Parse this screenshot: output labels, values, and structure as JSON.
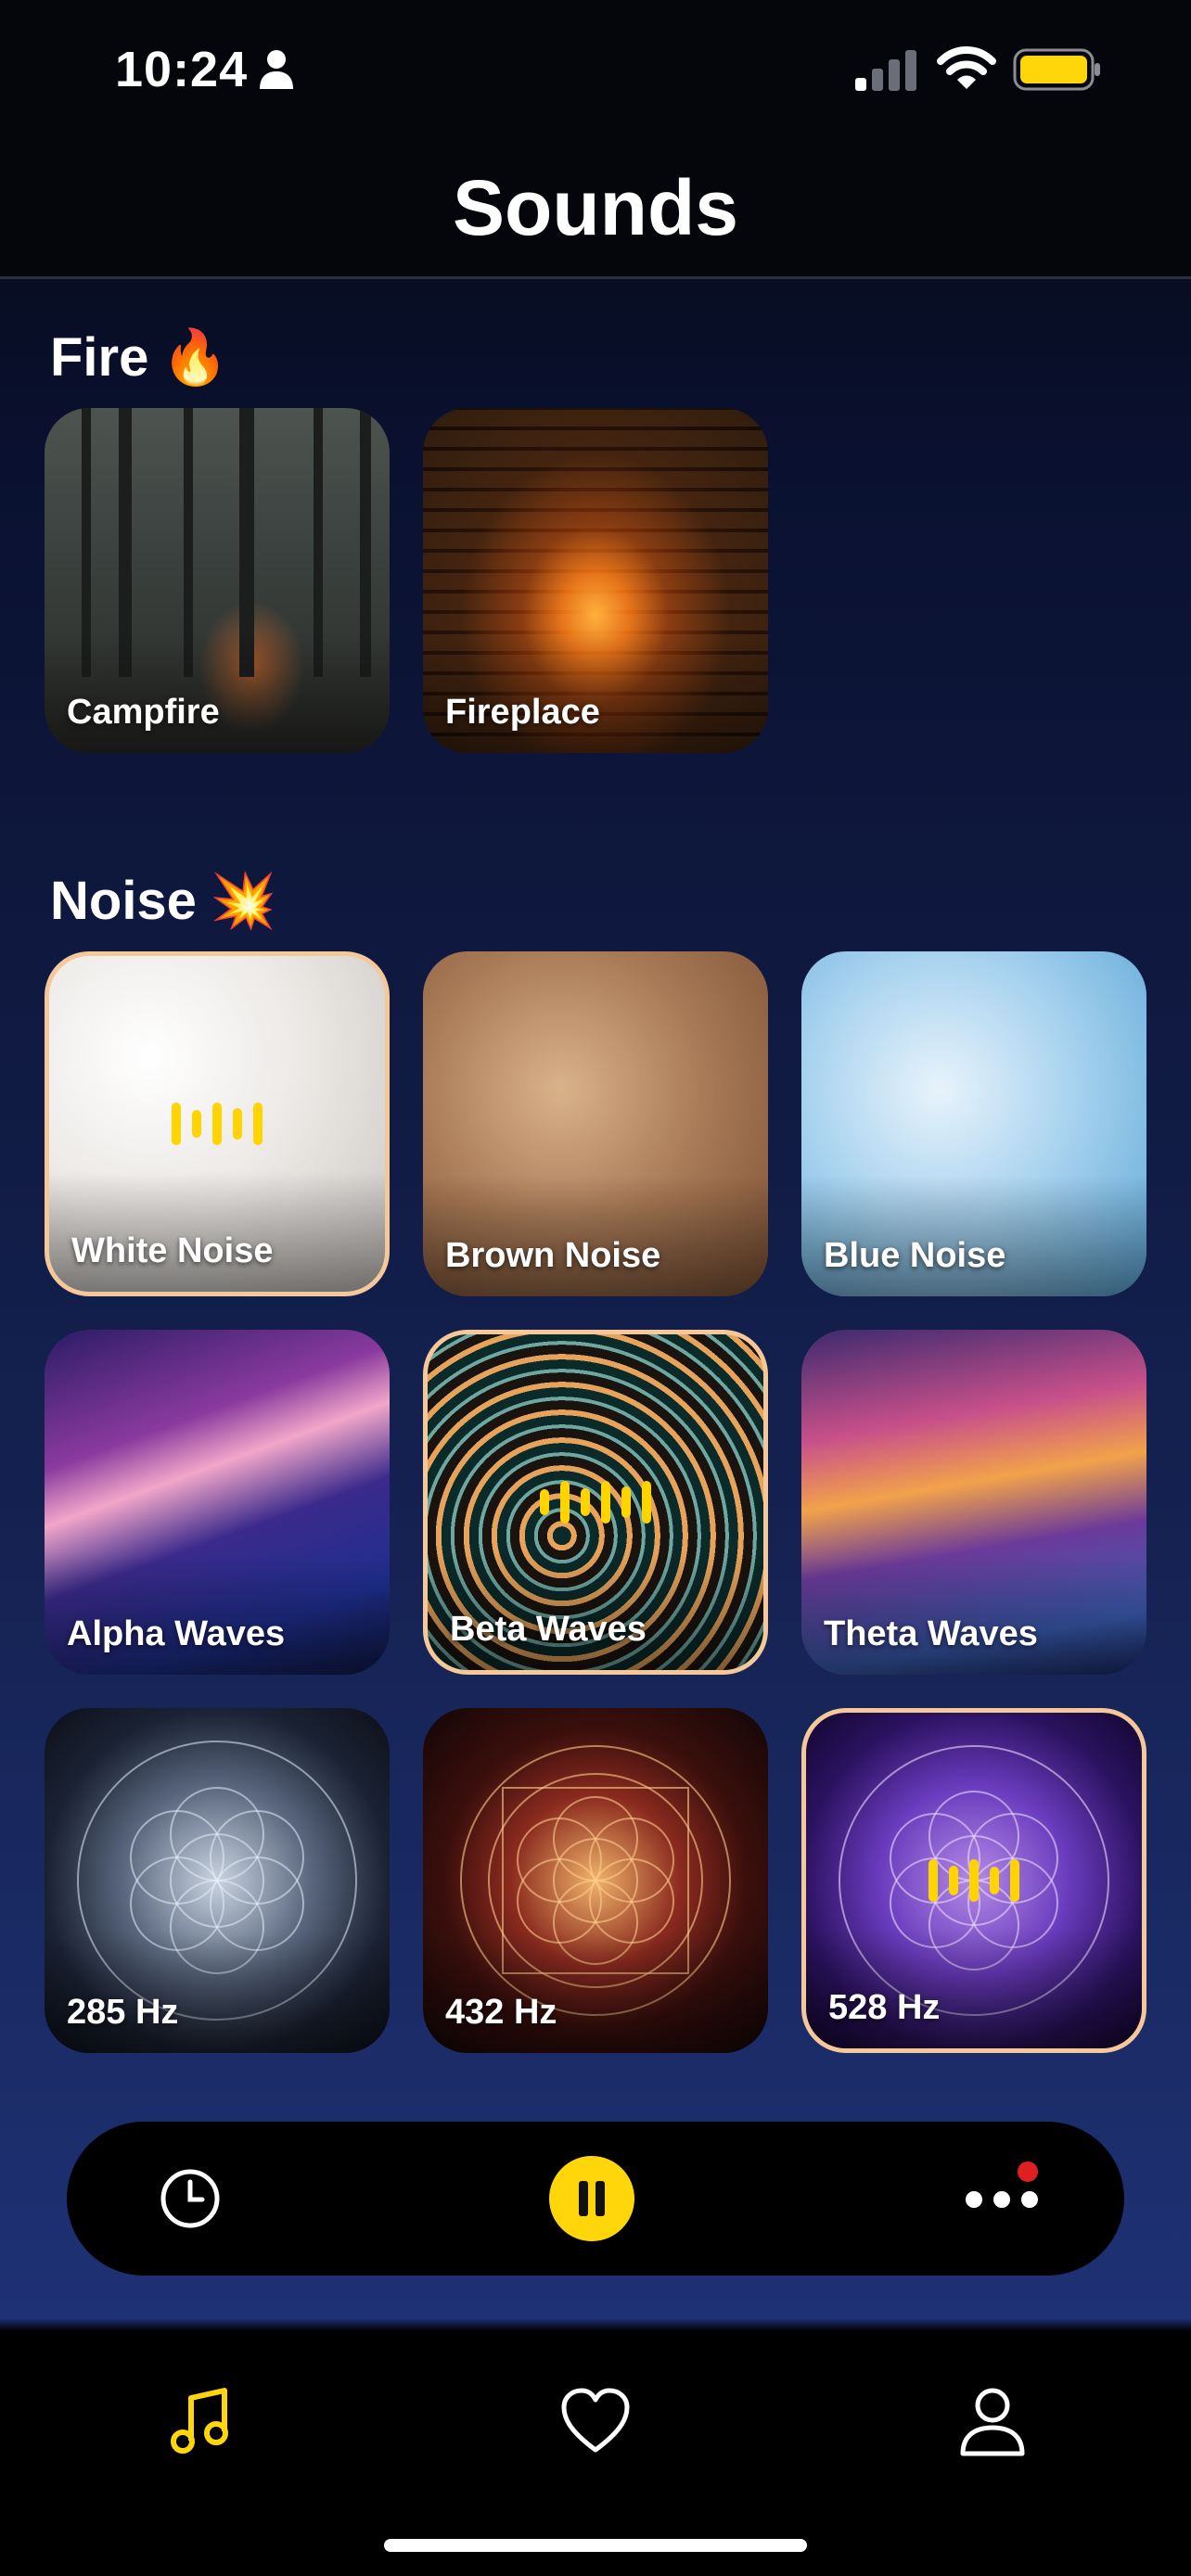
{
  "status_bar": {
    "time": "10:24",
    "signal_bars_active": 1,
    "signal_bars_total": 4,
    "battery_level": 0.8,
    "battery_color": "#ffd60a"
  },
  "header": {
    "title": "Sounds"
  },
  "sections": [
    {
      "title": "Fire",
      "emoji": "🔥",
      "items": [
        {
          "label": "Campfire",
          "selected": false
        },
        {
          "label": "Fireplace",
          "selected": false
        }
      ]
    },
    {
      "title": "Noise",
      "emoji": "💥",
      "items": [
        {
          "label": "White Noise",
          "selected": true
        },
        {
          "label": "Brown Noise",
          "selected": false
        },
        {
          "label": "Blue Noise",
          "selected": false
        },
        {
          "label": "Alpha Waves",
          "selected": false
        },
        {
          "label": "Beta Waves",
          "selected": true
        },
        {
          "label": "Theta Waves",
          "selected": false
        },
        {
          "label": "285 Hz",
          "selected": false
        },
        {
          "label": "432 Hz",
          "selected": false
        },
        {
          "label": "528 Hz",
          "selected": true
        }
      ]
    }
  ],
  "player": {
    "state": "playing",
    "has_notification": true
  },
  "tabs": [
    {
      "name": "sounds",
      "icon": "music-note-icon",
      "active": true
    },
    {
      "name": "favorites",
      "icon": "heart-icon",
      "active": false
    },
    {
      "name": "profile",
      "icon": "person-icon",
      "active": false
    }
  ],
  "colors": {
    "accent": "#ffd60a",
    "selected_border": "#f5c89a",
    "notification": "#e02020"
  }
}
